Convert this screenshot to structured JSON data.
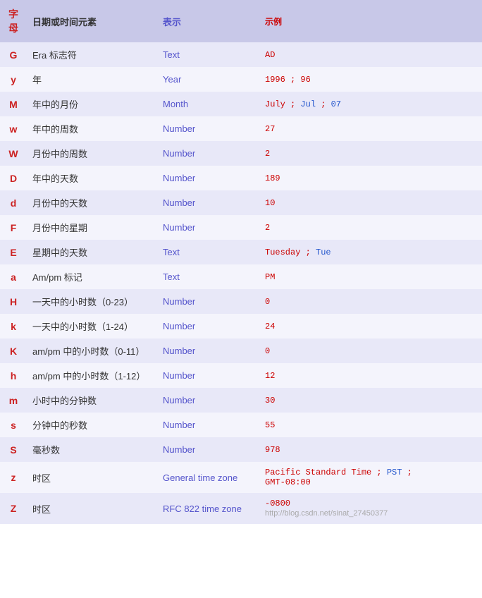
{
  "header": {
    "col_char": "字母",
    "col_element": "日期或时间元素",
    "col_repr": "表示",
    "col_example": "示例"
  },
  "rows": [
    {
      "char": "G",
      "element": "Era 标志符",
      "repr": "Text",
      "example": [
        {
          "text": "AD",
          "style": "normal"
        }
      ]
    },
    {
      "char": "y",
      "element": "年",
      "repr": "Year",
      "example": [
        {
          "text": "1996 ; 96",
          "style": "normal"
        }
      ]
    },
    {
      "char": "M",
      "element": "年中的月份",
      "repr": "Month",
      "example": [
        {
          "text": "July",
          "style": "normal"
        },
        {
          "text": " ; ",
          "style": "normal"
        },
        {
          "text": "Jul",
          "style": "blue"
        },
        {
          "text": " ; ",
          "style": "normal"
        },
        {
          "text": "07",
          "style": "blue"
        }
      ]
    },
    {
      "char": "w",
      "element": "年中的周数",
      "repr": "Number",
      "example": [
        {
          "text": "27",
          "style": "normal"
        }
      ]
    },
    {
      "char": "W",
      "element": "月份中的周数",
      "repr": "Number",
      "example": [
        {
          "text": "2",
          "style": "normal"
        }
      ]
    },
    {
      "char": "D",
      "element": "年中的天数",
      "repr": "Number",
      "example": [
        {
          "text": "189",
          "style": "normal"
        }
      ]
    },
    {
      "char": "d",
      "element": "月份中的天数",
      "repr": "Number",
      "example": [
        {
          "text": "10",
          "style": "normal"
        }
      ]
    },
    {
      "char": "F",
      "element": "月份中的星期",
      "repr": "Number",
      "example": [
        {
          "text": "2",
          "style": "normal"
        }
      ]
    },
    {
      "char": "E",
      "element": "星期中的天数",
      "repr": "Text",
      "example": [
        {
          "text": "Tuesday",
          "style": "normal"
        },
        {
          "text": " ; ",
          "style": "normal"
        },
        {
          "text": "Tue",
          "style": "blue"
        }
      ]
    },
    {
      "char": "a",
      "element": "Am/pm 标记",
      "repr": "Text",
      "example": [
        {
          "text": "PM",
          "style": "normal"
        }
      ]
    },
    {
      "char": "H",
      "element": "一天中的小时数（0-23）",
      "repr": "Number",
      "example": [
        {
          "text": "0",
          "style": "normal"
        }
      ]
    },
    {
      "char": "k",
      "element": "一天中的小时数（1-24）",
      "repr": "Number",
      "example": [
        {
          "text": "24",
          "style": "normal"
        }
      ]
    },
    {
      "char": "K",
      "element": "am/pm 中的小时数（0-11）",
      "repr": "Number",
      "example": [
        {
          "text": "0",
          "style": "normal"
        }
      ]
    },
    {
      "char": "h",
      "element": "am/pm 中的小时数（1-12）",
      "repr": "Number",
      "example": [
        {
          "text": "12",
          "style": "normal"
        }
      ]
    },
    {
      "char": "m",
      "element": "小时中的分钟数",
      "repr": "Number",
      "example": [
        {
          "text": "30",
          "style": "normal"
        }
      ]
    },
    {
      "char": "s",
      "element": "分钟中的秒数",
      "repr": "Number",
      "example": [
        {
          "text": "55",
          "style": "normal"
        }
      ]
    },
    {
      "char": "S",
      "element": "毫秒数",
      "repr": "Number",
      "example": [
        {
          "text": "978",
          "style": "normal"
        }
      ]
    },
    {
      "char": "z",
      "element": "时区",
      "repr": "General time zone",
      "example": [
        {
          "text": "Pacific Standard Time",
          "style": "normal"
        },
        {
          "text": " ; ",
          "style": "normal"
        },
        {
          "text": "PST",
          "style": "blue"
        },
        {
          "text": " ;",
          "style": "normal"
        },
        {
          "text": "\nGMT-08:00",
          "style": "normal"
        }
      ]
    },
    {
      "char": "Z",
      "element": "时区",
      "repr": "RFC 822 time zone",
      "example": [
        {
          "text": "-0800",
          "style": "normal"
        },
        {
          "text": "\nhttp://blog.csdn.net/sinat_27450377",
          "style": "watermark"
        }
      ]
    }
  ]
}
